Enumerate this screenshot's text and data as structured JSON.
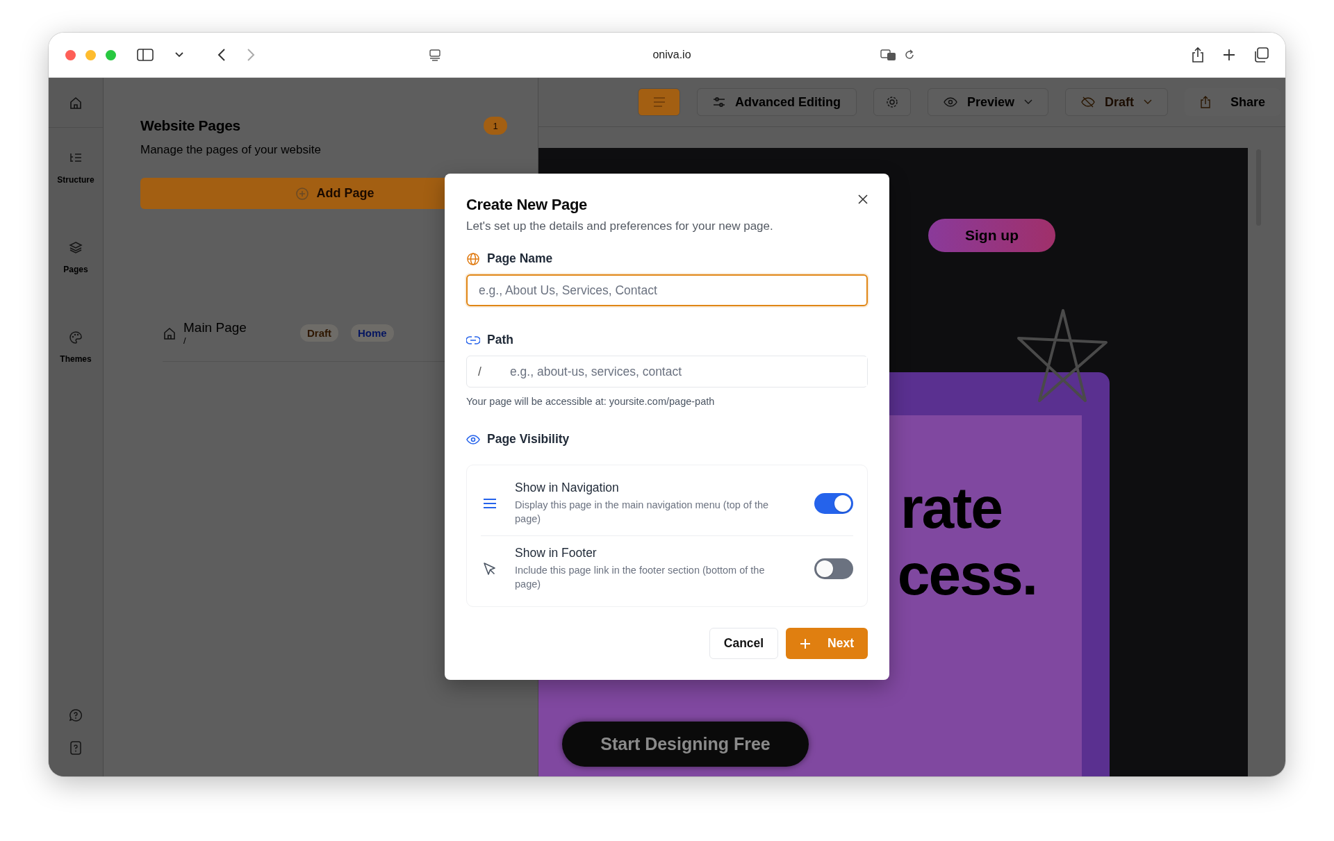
{
  "browser": {
    "url": "oniva.io"
  },
  "rail": {
    "items": [
      {
        "label": "Structure",
        "kind": "structure"
      },
      {
        "label": "Pages",
        "kind": "pages"
      },
      {
        "label": "Themes",
        "kind": "themes"
      }
    ]
  },
  "pages_panel": {
    "title": "Website Pages",
    "count": "1",
    "subtitle": "Manage the pages of your website",
    "add_button": "Add Page",
    "pages": [
      {
        "name": "Main Page",
        "path": "/",
        "tags": [
          {
            "label": "Draft",
            "color": "#2e1600"
          },
          {
            "label": "Home",
            "color": "#061660"
          }
        ]
      }
    ]
  },
  "toolbar": {
    "advanced": "Advanced Editing",
    "preview": "Preview",
    "draft": "Draft",
    "share": "Share"
  },
  "preview": {
    "signup": "Sign up",
    "headline": [
      "rate",
      "cess."
    ],
    "cta": "Start Designing Free"
  },
  "dialog": {
    "title": "Create New Page",
    "subtitle": "Let's set up the details and preferences for your new page.",
    "page_name": {
      "label": "Page Name",
      "placeholder": "e.g., About Us, Services, Contact"
    },
    "path": {
      "label": "Path",
      "prefix": "/",
      "placeholder": "e.g., about-us, services, contact",
      "hint": "Your page will be accessible at: yoursite.com/page-path"
    },
    "visibility": {
      "label": "Page Visibility",
      "options": [
        {
          "kind": "navigation",
          "title": "Show in Navigation",
          "description": "Display this page in the main navigation menu (top of the page)",
          "checked": true
        },
        {
          "kind": "footer",
          "title": "Show in Footer",
          "description": "Include this page link in the footer section (bottom of the page)",
          "checked": false
        }
      ]
    },
    "cancel": "Cancel",
    "next": "Next"
  }
}
